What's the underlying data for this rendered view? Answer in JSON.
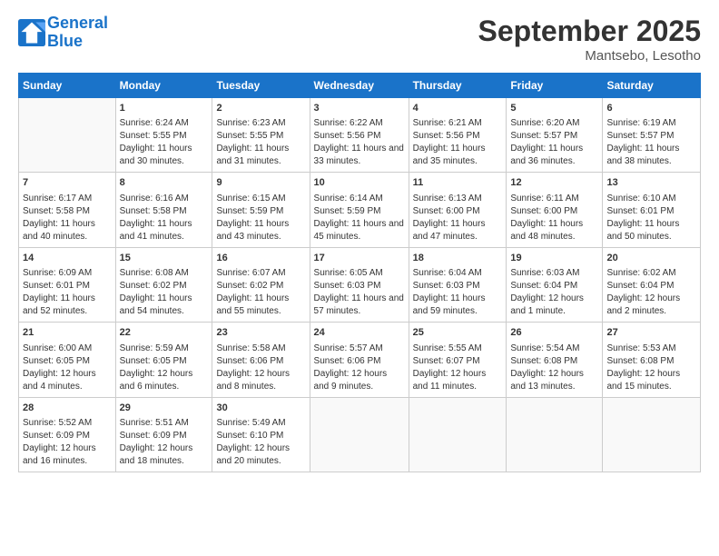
{
  "header": {
    "logo_line1": "General",
    "logo_line2": "Blue",
    "month": "September 2025",
    "location": "Mantsebo, Lesotho"
  },
  "days_of_week": [
    "Sunday",
    "Monday",
    "Tuesday",
    "Wednesday",
    "Thursday",
    "Friday",
    "Saturday"
  ],
  "weeks": [
    [
      {
        "day": "",
        "sunrise": "",
        "sunset": "",
        "daylight": ""
      },
      {
        "day": "1",
        "sunrise": "Sunrise: 6:24 AM",
        "sunset": "Sunset: 5:55 PM",
        "daylight": "Daylight: 11 hours and 30 minutes."
      },
      {
        "day": "2",
        "sunrise": "Sunrise: 6:23 AM",
        "sunset": "Sunset: 5:55 PM",
        "daylight": "Daylight: 11 hours and 31 minutes."
      },
      {
        "day": "3",
        "sunrise": "Sunrise: 6:22 AM",
        "sunset": "Sunset: 5:56 PM",
        "daylight": "Daylight: 11 hours and 33 minutes."
      },
      {
        "day": "4",
        "sunrise": "Sunrise: 6:21 AM",
        "sunset": "Sunset: 5:56 PM",
        "daylight": "Daylight: 11 hours and 35 minutes."
      },
      {
        "day": "5",
        "sunrise": "Sunrise: 6:20 AM",
        "sunset": "Sunset: 5:57 PM",
        "daylight": "Daylight: 11 hours and 36 minutes."
      },
      {
        "day": "6",
        "sunrise": "Sunrise: 6:19 AM",
        "sunset": "Sunset: 5:57 PM",
        "daylight": "Daylight: 11 hours and 38 minutes."
      }
    ],
    [
      {
        "day": "7",
        "sunrise": "Sunrise: 6:17 AM",
        "sunset": "Sunset: 5:58 PM",
        "daylight": "Daylight: 11 hours and 40 minutes."
      },
      {
        "day": "8",
        "sunrise": "Sunrise: 6:16 AM",
        "sunset": "Sunset: 5:58 PM",
        "daylight": "Daylight: 11 hours and 41 minutes."
      },
      {
        "day": "9",
        "sunrise": "Sunrise: 6:15 AM",
        "sunset": "Sunset: 5:59 PM",
        "daylight": "Daylight: 11 hours and 43 minutes."
      },
      {
        "day": "10",
        "sunrise": "Sunrise: 6:14 AM",
        "sunset": "Sunset: 5:59 PM",
        "daylight": "Daylight: 11 hours and 45 minutes."
      },
      {
        "day": "11",
        "sunrise": "Sunrise: 6:13 AM",
        "sunset": "Sunset: 6:00 PM",
        "daylight": "Daylight: 11 hours and 47 minutes."
      },
      {
        "day": "12",
        "sunrise": "Sunrise: 6:11 AM",
        "sunset": "Sunset: 6:00 PM",
        "daylight": "Daylight: 11 hours and 48 minutes."
      },
      {
        "day": "13",
        "sunrise": "Sunrise: 6:10 AM",
        "sunset": "Sunset: 6:01 PM",
        "daylight": "Daylight: 11 hours and 50 minutes."
      }
    ],
    [
      {
        "day": "14",
        "sunrise": "Sunrise: 6:09 AM",
        "sunset": "Sunset: 6:01 PM",
        "daylight": "Daylight: 11 hours and 52 minutes."
      },
      {
        "day": "15",
        "sunrise": "Sunrise: 6:08 AM",
        "sunset": "Sunset: 6:02 PM",
        "daylight": "Daylight: 11 hours and 54 minutes."
      },
      {
        "day": "16",
        "sunrise": "Sunrise: 6:07 AM",
        "sunset": "Sunset: 6:02 PM",
        "daylight": "Daylight: 11 hours and 55 minutes."
      },
      {
        "day": "17",
        "sunrise": "Sunrise: 6:05 AM",
        "sunset": "Sunset: 6:03 PM",
        "daylight": "Daylight: 11 hours and 57 minutes."
      },
      {
        "day": "18",
        "sunrise": "Sunrise: 6:04 AM",
        "sunset": "Sunset: 6:03 PM",
        "daylight": "Daylight: 11 hours and 59 minutes."
      },
      {
        "day": "19",
        "sunrise": "Sunrise: 6:03 AM",
        "sunset": "Sunset: 6:04 PM",
        "daylight": "Daylight: 12 hours and 1 minute."
      },
      {
        "day": "20",
        "sunrise": "Sunrise: 6:02 AM",
        "sunset": "Sunset: 6:04 PM",
        "daylight": "Daylight: 12 hours and 2 minutes."
      }
    ],
    [
      {
        "day": "21",
        "sunrise": "Sunrise: 6:00 AM",
        "sunset": "Sunset: 6:05 PM",
        "daylight": "Daylight: 12 hours and 4 minutes."
      },
      {
        "day": "22",
        "sunrise": "Sunrise: 5:59 AM",
        "sunset": "Sunset: 6:05 PM",
        "daylight": "Daylight: 12 hours and 6 minutes."
      },
      {
        "day": "23",
        "sunrise": "Sunrise: 5:58 AM",
        "sunset": "Sunset: 6:06 PM",
        "daylight": "Daylight: 12 hours and 8 minutes."
      },
      {
        "day": "24",
        "sunrise": "Sunrise: 5:57 AM",
        "sunset": "Sunset: 6:06 PM",
        "daylight": "Daylight: 12 hours and 9 minutes."
      },
      {
        "day": "25",
        "sunrise": "Sunrise: 5:55 AM",
        "sunset": "Sunset: 6:07 PM",
        "daylight": "Daylight: 12 hours and 11 minutes."
      },
      {
        "day": "26",
        "sunrise": "Sunrise: 5:54 AM",
        "sunset": "Sunset: 6:08 PM",
        "daylight": "Daylight: 12 hours and 13 minutes."
      },
      {
        "day": "27",
        "sunrise": "Sunrise: 5:53 AM",
        "sunset": "Sunset: 6:08 PM",
        "daylight": "Daylight: 12 hours and 15 minutes."
      }
    ],
    [
      {
        "day": "28",
        "sunrise": "Sunrise: 5:52 AM",
        "sunset": "Sunset: 6:09 PM",
        "daylight": "Daylight: 12 hours and 16 minutes."
      },
      {
        "day": "29",
        "sunrise": "Sunrise: 5:51 AM",
        "sunset": "Sunset: 6:09 PM",
        "daylight": "Daylight: 12 hours and 18 minutes."
      },
      {
        "day": "30",
        "sunrise": "Sunrise: 5:49 AM",
        "sunset": "Sunset: 6:10 PM",
        "daylight": "Daylight: 12 hours and 20 minutes."
      },
      {
        "day": "",
        "sunrise": "",
        "sunset": "",
        "daylight": ""
      },
      {
        "day": "",
        "sunrise": "",
        "sunset": "",
        "daylight": ""
      },
      {
        "day": "",
        "sunrise": "",
        "sunset": "",
        "daylight": ""
      },
      {
        "day": "",
        "sunrise": "",
        "sunset": "",
        "daylight": ""
      }
    ]
  ]
}
